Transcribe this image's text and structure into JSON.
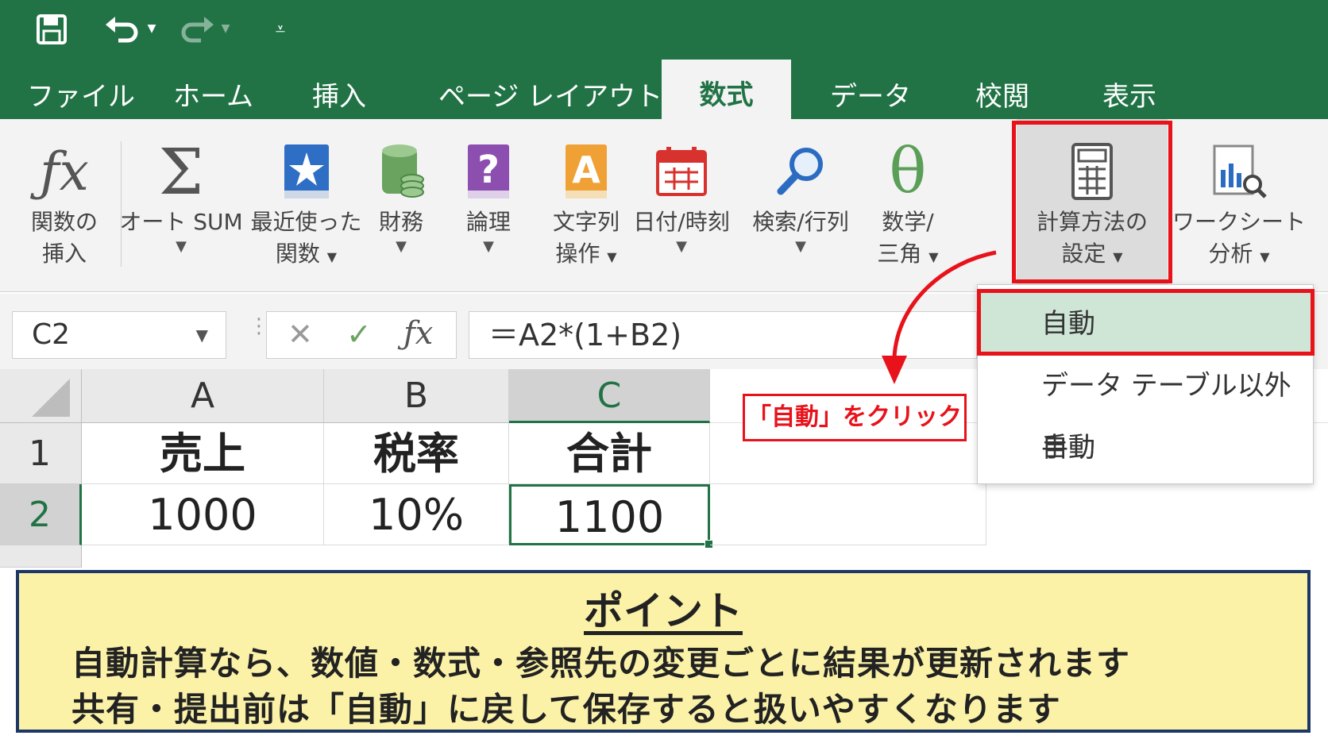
{
  "colors": {
    "excel_green": "#217346",
    "highlight_red": "#e8121b",
    "menu_selected": "#cfe6d6",
    "point_bg": "#fbf2a8",
    "point_border": "#1d3766"
  },
  "qat": {
    "icons": [
      "save-icon",
      "undo-icon",
      "redo-icon",
      "customize-icon"
    ]
  },
  "tabs": [
    {
      "label": "ファイル"
    },
    {
      "label": "ホーム"
    },
    {
      "label": "挿入"
    },
    {
      "label": "ページ レイアウト"
    },
    {
      "label": "数式"
    },
    {
      "label": "データ"
    },
    {
      "label": "校閲"
    },
    {
      "label": "表示"
    }
  ],
  "ribbon": {
    "insert_function": {
      "line1": "関数の",
      "line2": "挿入",
      "icon": "fx-icon"
    },
    "autosum": {
      "line1": "オート SUM",
      "icon": "sigma-icon"
    },
    "recent": {
      "line1": "最近使った",
      "line2": "関数",
      "icon": "star-book-icon"
    },
    "financial": {
      "line1": "財務",
      "icon": "coins-icon"
    },
    "logical": {
      "line1": "論理",
      "icon": "question-book-icon"
    },
    "text": {
      "line1": "文字列",
      "line2": "操作",
      "icon": "text-book-icon"
    },
    "datetime": {
      "line1": "日付/時刻",
      "icon": "calendar-icon"
    },
    "lookup": {
      "line1": "検索/行列",
      "icon": "magnifier-icon"
    },
    "math": {
      "line1": "数学/",
      "line2": "三角",
      "icon": "theta-icon"
    },
    "calc_options": {
      "line1": "計算方法の",
      "line2": "設定",
      "icon": "calculator-icon"
    },
    "worksheet_analysis": {
      "line1": "ワークシート",
      "line2": "分析",
      "icon": "chart-magnifier-icon"
    }
  },
  "formula_bar": {
    "name_box": "C2",
    "formula": "＝A2*(1+B2)"
  },
  "grid": {
    "columns": [
      "A",
      "B",
      "C"
    ],
    "rows": [
      {
        "num": "1",
        "cells": [
          "売上",
          "税率",
          "合計"
        ]
      },
      {
        "num": "2",
        "cells": [
          "1000",
          "10%",
          "1100"
        ]
      }
    ]
  },
  "calc_menu": {
    "items": [
      {
        "label": "自動"
      },
      {
        "label": "データ テーブル以外自動"
      },
      {
        "label": "手動"
      }
    ]
  },
  "callout": "「自動」をクリック",
  "point": {
    "title": "ポイント",
    "line1": "自動計算なら、数値・数式・参照先の変更ごとに結果が更新されます",
    "line2": "共有・提出前は「自動」に戻して保存すると扱いやすくなります"
  }
}
